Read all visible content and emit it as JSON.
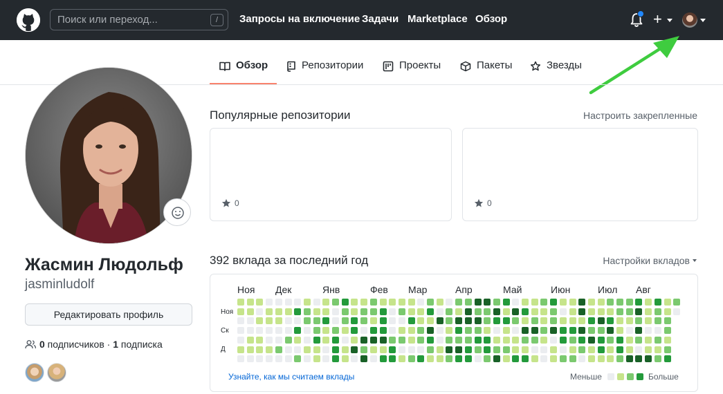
{
  "header": {
    "search_placeholder": "Поиск или переход...",
    "search_shortcut": "/",
    "nav": [
      "Запросы на включение",
      "Задачи",
      "Marketplace",
      "Обзор"
    ],
    "plus_label": "+",
    "notification_dot_color": "#2188ff"
  },
  "tabs": [
    {
      "label": "Обзор",
      "icon": "book-icon",
      "selected": true
    },
    {
      "label": "Репозитории",
      "icon": "repo-icon",
      "selected": false
    },
    {
      "label": "Проекты",
      "icon": "project-icon",
      "selected": false
    },
    {
      "label": "Пакеты",
      "icon": "package-icon",
      "selected": false
    },
    {
      "label": "Звезды",
      "icon": "star-icon",
      "selected": false
    }
  ],
  "profile": {
    "name": "Жасмин Людольф",
    "login": "jasminludolf",
    "edit_button": "Редактировать профиль",
    "followers_count": "0",
    "followers_label": " подписчиков · ",
    "following_count": "1",
    "following_label": " подписка"
  },
  "pinned": {
    "title": "Популярные репозитории",
    "customize_link": "Настроить закрепленные",
    "cards": [
      {
        "stars": "0"
      },
      {
        "stars": "0"
      }
    ]
  },
  "contributions": {
    "title": "392 вклада за последний год",
    "settings": "Настройки вкладов",
    "months": [
      "Ноя",
      "Дек",
      "Янв",
      "Фев",
      "Мар",
      "Апр",
      "Май",
      "Июн",
      "Июл",
      "Авг"
    ],
    "days": [
      "Ноя",
      "Ск",
      "Д"
    ],
    "learn_link": "Узнайте, как мы считаем вклады",
    "legend_less": "Меньше",
    "legend_more": "Больше",
    "colors": [
      "#ebedf0",
      "#c6e48b",
      "#7bc96f",
      "#239a3b",
      "#196127"
    ]
  }
}
